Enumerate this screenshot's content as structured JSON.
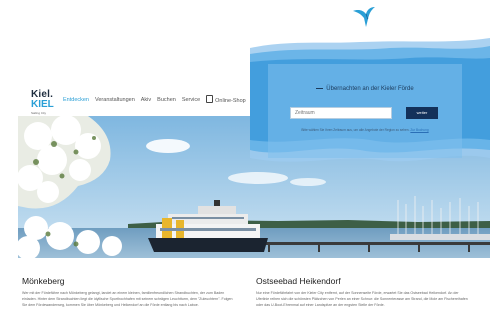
{
  "header": {
    "logo": {
      "line1": "Kiel.",
      "line2": "KIEL",
      "sub": "Sailing City"
    },
    "nav": [
      {
        "label": "Entdecken",
        "active": true
      },
      {
        "label": "Veranstaltungen",
        "active": false
      },
      {
        "label": "Akiv",
        "active": false
      },
      {
        "label": "Buchen",
        "active": false
      },
      {
        "label": "Service",
        "active": false
      },
      {
        "label": "Online-Shop",
        "active": false,
        "icon": "shopping-bag-icon"
      }
    ]
  },
  "booking": {
    "title": "Übernachten an der Kieler Förde",
    "date_placeholder": "Zeitraum",
    "search_label": "weiter",
    "note_text": "Bitte wählen Sie Ihren Zeitraum aus, um alle Angebote der Region zu sehen.",
    "note_link": "Zur Buchung"
  },
  "colors": {
    "accent": "#2a9fd6",
    "navy": "#13315a",
    "wave": "#4aa3e0"
  },
  "articles": [
    {
      "title": "Mönkeberg",
      "text": "Wer mit der Fördefähre nach Mönkeberg gelangt, landet an einem kleinen, familienfreundlichen Strandbuchten, der zum Baden einladen. Hinter dem Strandbuchten liegt die idyllische Sporthochhafen mit seinem schrägen Leuchtturm, dem \"Zuleuchtern\". Folgen Sie dem Fördewanderweg, kommen Sie über Mönkeberg und Heikendorf an die Förde entlang bis nach Laboe."
    },
    {
      "title": "Ostseebad Heikendorf",
      "text": "Nur eine Fördefährfahrt von der Kieler City entfernt, auf der Sonnenseite Förde, erwartet Sie das Ostseebad Heikendorf. An der Uferlinie reihen sich die schönsten Plätzchen von Perlen an einer Schnur: die Sonnenterasse am Strand, die Mole am Fischereihafen oder das U-Boot-Ehrenmal auf einer Landspitze an der engsten Stelle der Förde."
    }
  ]
}
